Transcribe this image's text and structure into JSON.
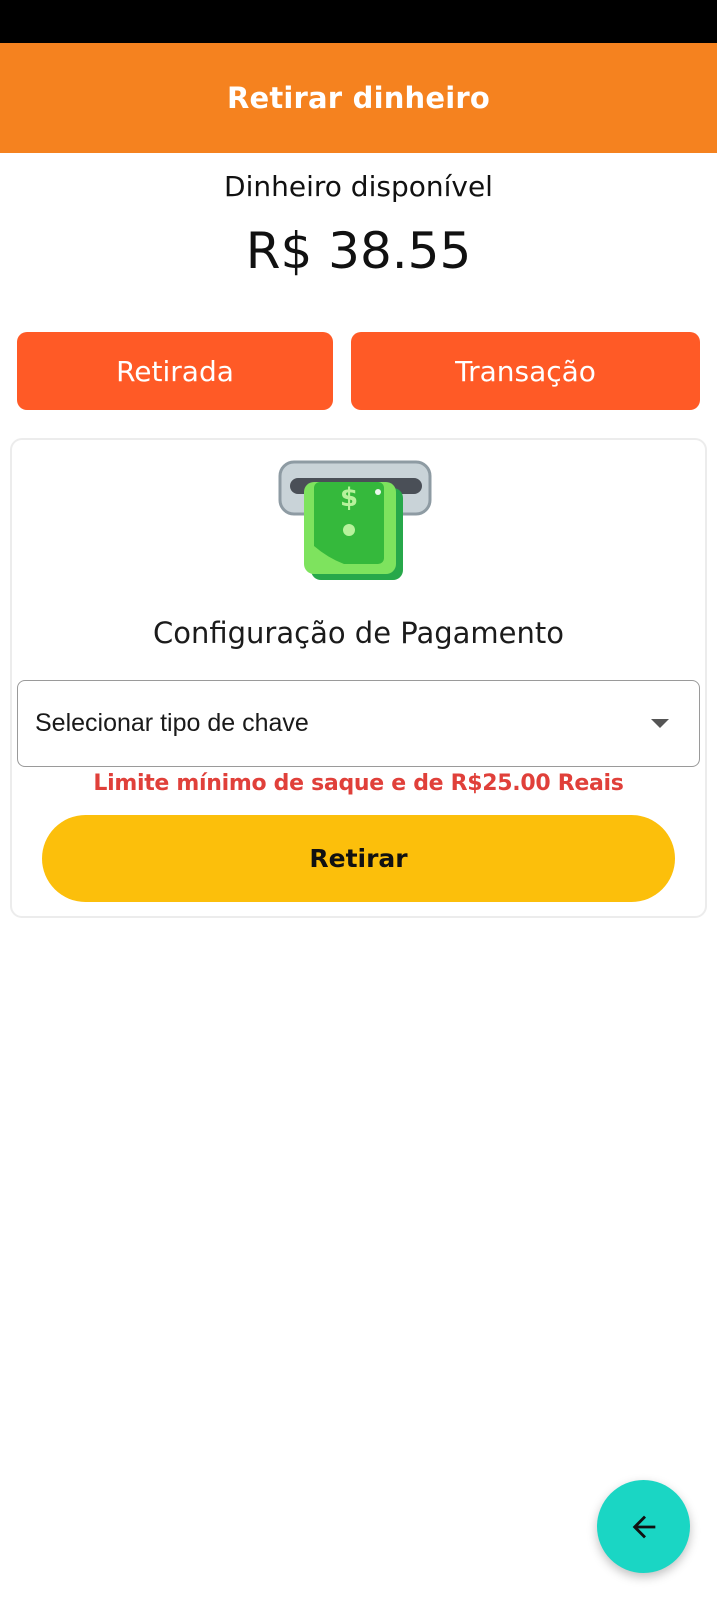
{
  "header": {
    "title": "Retirar dinheiro"
  },
  "balance": {
    "label": "Dinheiro disponível",
    "value": "R$ 38.55"
  },
  "tabs": [
    {
      "label": "Retirada"
    },
    {
      "label": "Transação"
    }
  ],
  "payment": {
    "title": "Configuração de Pagamento",
    "key_select": {
      "value": "Selecionar tipo de chave"
    },
    "warning": "Limite mínimo de saque e de R$25.00 Reais",
    "submit_label": "Retirar"
  },
  "icons": {
    "illustration": "atm-cash-icon",
    "back": "arrow-left-icon"
  },
  "colors": {
    "header": "#f5821f",
    "tab": "#ff5a26",
    "warning": "#e0403a",
    "submit": "#fcbf0b",
    "fab": "#1ad6c4"
  }
}
